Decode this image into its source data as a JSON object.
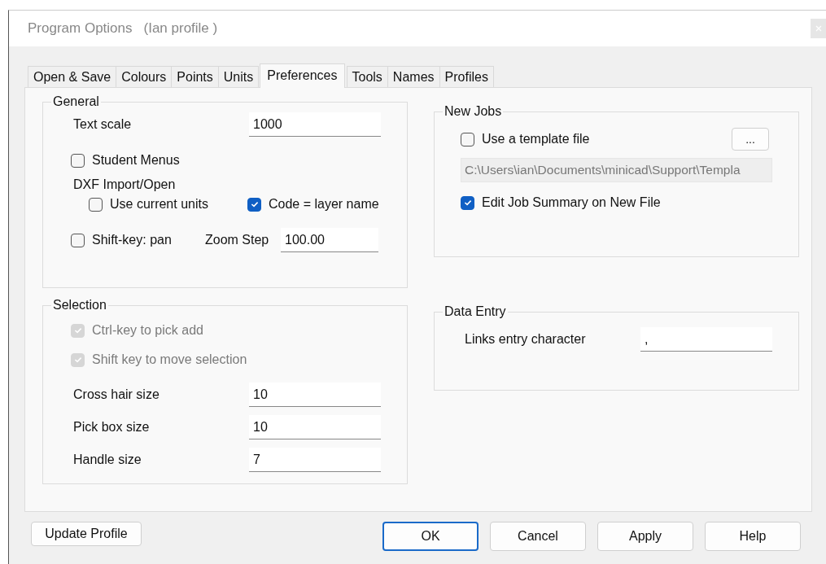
{
  "window": {
    "title": "Program Options",
    "subtitle": "(Ian profile )"
  },
  "tabs": [
    {
      "label": "Open & Save",
      "selected": false
    },
    {
      "label": "Colours",
      "selected": false
    },
    {
      "label": "Points",
      "selected": false
    },
    {
      "label": "Units",
      "selected": false
    },
    {
      "label": "Preferences",
      "selected": true
    },
    {
      "label": "Tools",
      "selected": false
    },
    {
      "label": "Names",
      "selected": false
    },
    {
      "label": "Profiles",
      "selected": false
    }
  ],
  "general": {
    "title": "General",
    "text_scale": {
      "label": "Text scale",
      "value": "1000"
    },
    "student_menus": {
      "label": "Student Menus",
      "checked": false,
      "disabled": false
    },
    "dxf_heading": "DXF Import/Open",
    "use_current_units": {
      "label": "Use current units",
      "checked": false,
      "disabled": false
    },
    "code_layer_name": {
      "label": "Code = layer name",
      "checked": true,
      "disabled": false
    },
    "shift_key_pan": {
      "label": "Shift-key: pan",
      "checked": false,
      "disabled": false
    },
    "zoom_step": {
      "label": "Zoom Step",
      "value": "100.00"
    }
  },
  "new_jobs": {
    "title": "New Jobs",
    "use_template": {
      "label": "Use a template file",
      "checked": false,
      "disabled": false
    },
    "browse_button": "...",
    "template_path": "C:\\Users\\ian\\Documents\\minicad\\Support\\Templa",
    "edit_job_summary": {
      "label": "Edit Job Summary on New File",
      "checked": true,
      "disabled": false
    }
  },
  "selection": {
    "title": "Selection",
    "checks": [
      {
        "label": "Ctrl-key to pick add",
        "checked": true,
        "disabled": true
      },
      {
        "label": "Shift key to move selection",
        "checked": true,
        "disabled": true
      }
    ],
    "fields": [
      {
        "label": "Cross hair size",
        "value": "10"
      },
      {
        "label": "Pick box size",
        "value": "10"
      },
      {
        "label": "Handle size",
        "value": "7"
      }
    ]
  },
  "data_entry": {
    "title": "Data Entry",
    "field": {
      "label": "Links entry character",
      "value": ","
    }
  },
  "buttons": [
    {
      "label": "Update Profile",
      "kind": "left",
      "default": false
    },
    {
      "label": "OK",
      "kind": "right",
      "default": true
    },
    {
      "label": "Cancel",
      "kind": "right",
      "default": false
    },
    {
      "label": "Apply",
      "kind": "right",
      "default": false
    },
    {
      "label": "Help",
      "kind": "right",
      "default": false
    }
  ]
}
